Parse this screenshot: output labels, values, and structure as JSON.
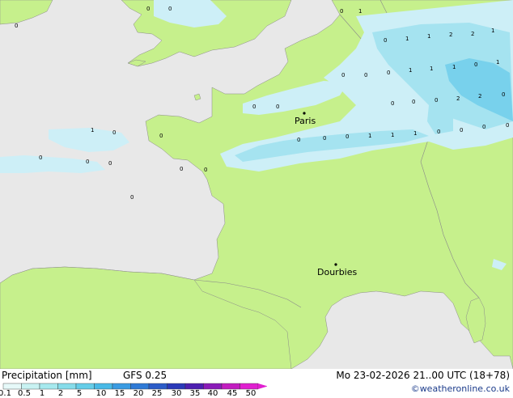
{
  "footer": {
    "title": "Precipitation [mm]",
    "model": "GFS 0.25",
    "datetime": "Mo 23-02-2026 21..00 UTC (18+78)",
    "credit": "©weatheronline.co.uk"
  },
  "legend": {
    "ticks": [
      "0.1",
      "0.5",
      "1",
      "2",
      "5",
      "10",
      "15",
      "20",
      "25",
      "30",
      "35",
      "40",
      "45",
      "50"
    ],
    "colors": [
      "#e6f9f9",
      "#c8f2f2",
      "#a6e9ee",
      "#86dcea",
      "#65cde8",
      "#49b9e6",
      "#3a9be2",
      "#2f7ad6",
      "#2c5cc8",
      "#2a39b8",
      "#4d1fb0",
      "#8a1bb8",
      "#c21dc0",
      "#e020d0"
    ]
  },
  "colors": {
    "sea": "#e8e8e8",
    "land": "#c6f08c",
    "precip_light": "#cdeff7",
    "precip_mid": "#a5e3f0",
    "precip_heavy": "#78d1ec",
    "border": "#8a8a8a"
  },
  "cities": [
    {
      "name": "Paris"
    },
    {
      "name": "Dourbies"
    }
  ],
  "values": [
    "0",
    "0",
    "0",
    "0",
    "1",
    "0",
    "1",
    "1",
    "2",
    "2",
    "1",
    "0",
    "0",
    "1",
    "1",
    "1",
    "0",
    "1",
    "2",
    "2",
    "0",
    "0",
    "0",
    "0",
    "0",
    "0",
    "0",
    "0",
    "0",
    "0",
    "1",
    "1",
    "1",
    "0",
    "0",
    "0",
    "0",
    "1",
    "0",
    "0",
    "0",
    "0",
    "0",
    "0",
    "0",
    "0",
    "0",
    "1",
    "0"
  ]
}
